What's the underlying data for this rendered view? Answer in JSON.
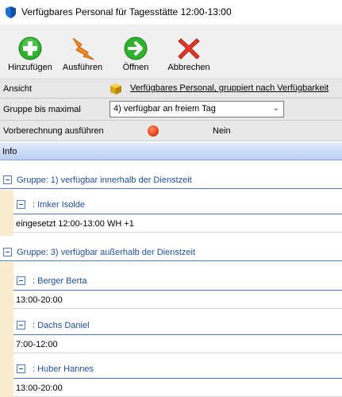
{
  "window": {
    "title": "Verfügbares Personal für Tagesstätte 12:00-13:00"
  },
  "toolbar": {
    "add_label": "Hinzufügen",
    "run_label": "Ausführen",
    "open_label": "Öffnen",
    "cancel_label": "Abbrechen"
  },
  "properties": {
    "view_label": "Ansicht",
    "view_value": "Verfügbares Personal, gruppiert nach Verfügbarkeit",
    "group_label": "Gruppe bis maximal",
    "group_value": "4) verfügbar an freiem Tag",
    "precalc_label": "Vorberechnung ausführen",
    "precalc_value": "Nein"
  },
  "info": {
    "header": "Info"
  },
  "groups": [
    {
      "title": "Gruppe: 1) verfügbar innerhalb der Dienstzeit",
      "persons": [
        {
          "name": ": Imker Isolde",
          "detail": "eingesetzt 12:00-13:00 WH +1"
        }
      ]
    },
    {
      "title": "Gruppe: 3) verfügbar außerhalb der Dienstzeit",
      "persons": [
        {
          "name": ": Berger Berta",
          "detail": "13:00-20:00"
        },
        {
          "name": ": Dachs Daniel",
          "detail": "7:00-12:00"
        },
        {
          "name": ": Huber Hannes",
          "detail": "13:00-20:00"
        }
      ]
    }
  ],
  "colors": {
    "accent": "#1f4e9c",
    "indent": "#f9ebcf",
    "info_header": "#bcd0f2",
    "status_dot": "#e0401a"
  }
}
